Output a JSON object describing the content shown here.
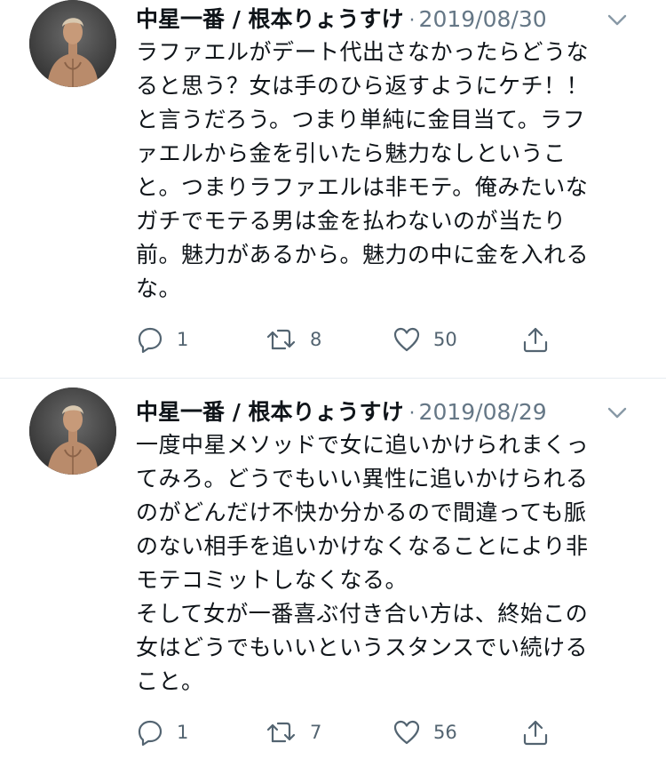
{
  "tweets": [
    {
      "author": "中星一番 / 根本りょうすけ",
      "separator": "·",
      "date": "2019/08/30",
      "lines": [
        "ラファエルがデート代出さなかったらどうな",
        "ると思う？女は手のひら返すようにケチ！！",
        "と言うだろう。つまり単純に金目当て。ラフ",
        "ァエルから金を引いたら魅力なしというこ",
        "と。つまりラファエルは非モテ。俺みたいな",
        "ガチでモテる男は金を払わないのが当たり",
        "前。魅力があるから。魅力の中に金を入れる",
        "な。"
      ],
      "replies": "1",
      "retweets": "8",
      "likes": "50"
    },
    {
      "author": "中星一番 / 根本りょうすけ",
      "separator": "·",
      "date": "2019/08/29",
      "lines": [
        "一度中星メソッドで女に追いかけられまくっ",
        "てみろ。どうでもいい異性に追いかけられる",
        "のがどんだけ不快か分かるので間違っても脈",
        "のない相手を追いかけなくなることにより非",
        "モテコミットしなくなる。",
        "そして女が一番喜ぶ付き合い方は、終始この",
        "女はどうでもいいというスタンスでい続ける",
        "こと。"
      ],
      "replies": "1",
      "retweets": "7",
      "likes": "56"
    }
  ],
  "colors": {
    "text": "#0f1419",
    "secondary": "#657786",
    "divider": "#e6ecf0"
  },
  "icons": [
    "avatar-photo",
    "chevron-down-icon",
    "reply-icon",
    "retweet-icon",
    "like-icon",
    "share-icon"
  ]
}
